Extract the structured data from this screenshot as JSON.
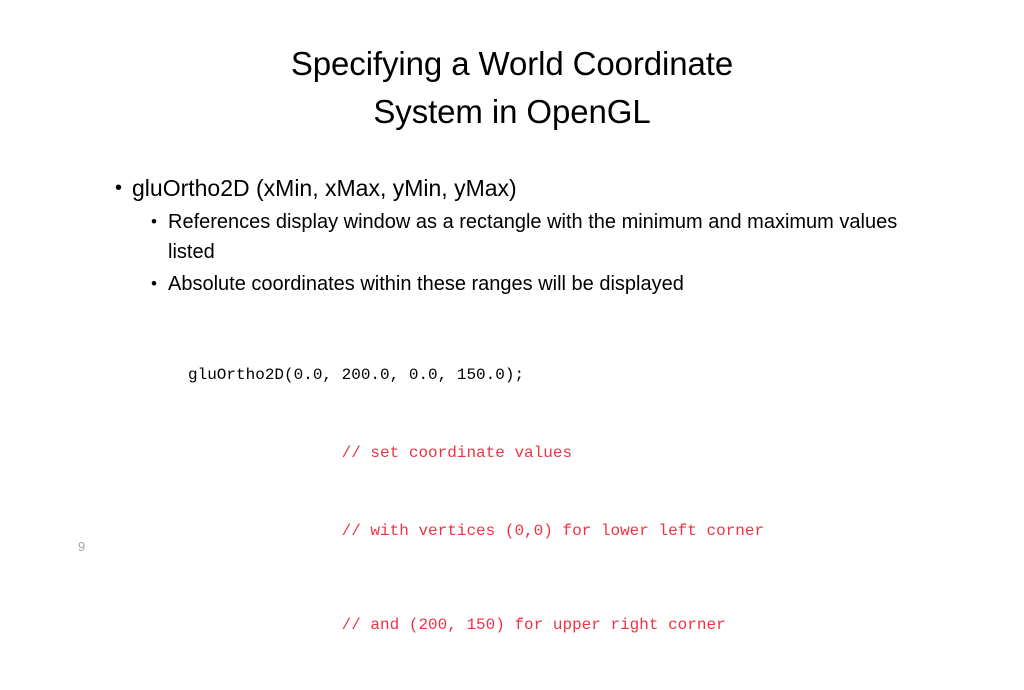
{
  "slide": {
    "background_color": "#ffffff",
    "title": {
      "lines": [
        "Specifying a World Coordinate",
        "System in OpenGL"
      ]
    },
    "body": {
      "level1": {
        "bullet_glyph": "•",
        "text": "gluOrtho2D (xMin, xMax, yMin, yMax)"
      },
      "level2": [
        {
          "bullet_glyph": "•",
          "text": "References display window as a rectangle with the minimum and maximum values listed"
        },
        {
          "bullet_glyph": "•",
          "text": "Absolute coordinates within these ranges will be displayed"
        }
      ]
    },
    "code": {
      "color_code": "#000000",
      "color_comment": "#ee3344",
      "lines": [
        {
          "kind": "code",
          "text": "gluOrtho2D(0.0, 200.0, 0.0, 150.0);"
        },
        {
          "kind": "comment",
          "text": "                // set coordinate values"
        },
        {
          "kind": "comment",
          "text": "                // with vertices (0,0) for lower left corner"
        },
        {
          "kind": "comment",
          "text": "                // and (200, 150) for upper right corner"
        }
      ]
    },
    "footer": {
      "page_number": "9",
      "page_number_color": "#a6a6a6"
    }
  }
}
